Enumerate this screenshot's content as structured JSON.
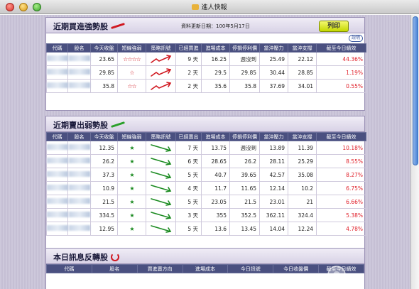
{
  "window": {
    "title": "進人快報"
  },
  "top_panel": {
    "title": "近期買進強勢股",
    "update_text": "資料更新日期：100年5月17日",
    "print_label": "列印",
    "help_label": "說明",
    "columns": [
      "代碼",
      "股名",
      "今天收盤",
      "短線強弱",
      "策略訊號",
      "已經買進",
      "進場成本",
      "停損停利價",
      "當沖壓力",
      "當沖支撐",
      "截至今日績效"
    ],
    "rows": [
      {
        "close": "23.65",
        "stars": "☆☆☆☆",
        "days": "9 天",
        "cost": "16.25",
        "stop": "週沒到",
        "resist": "25.49",
        "support": "22.12",
        "perf": "44.36%"
      },
      {
        "close": "29.85",
        "stars": "☆",
        "days": "2 天",
        "cost": "29.5",
        "stop": "29.85",
        "resist": "30.44",
        "support": "28.85",
        "perf": "1.19%"
      },
      {
        "close": "35.8",
        "stars": "☆☆",
        "days": "2 天",
        "cost": "35.6",
        "stop": "35.8",
        "resist": "37.69",
        "support": "34.01",
        "perf": "0.55%"
      }
    ]
  },
  "mid_panel": {
    "title": "近期賣出弱勢股",
    "columns": [
      "代碼",
      "股名",
      "今天收盤",
      "短線強弱",
      "策略訊號",
      "已經賣出",
      "進場成本",
      "停損停利價",
      "當沖壓力",
      "當沖支撐",
      "截至今日績效"
    ],
    "rows": [
      {
        "close": "12.35",
        "stars": "★",
        "days": "7 天",
        "cost": "13.75",
        "stop": "週沒到",
        "resist": "13.89",
        "support": "11.39",
        "perf": "10.18%"
      },
      {
        "close": "26.2",
        "stars": "★",
        "days": "6 天",
        "cost": "28.65",
        "stop": "26.2",
        "resist": "28.11",
        "support": "25.29",
        "perf": "8.55%"
      },
      {
        "close": "37.3",
        "stars": "★",
        "days": "5 天",
        "cost": "40.7",
        "stop": "39.65",
        "resist": "42.57",
        "support": "35.08",
        "perf": "8.27%"
      },
      {
        "close": "10.9",
        "stars": "★",
        "days": "4 天",
        "cost": "11.7",
        "stop": "11.65",
        "resist": "12.14",
        "support": "10.2",
        "perf": "6.75%"
      },
      {
        "close": "21.5",
        "stars": "★",
        "days": "5 天",
        "cost": "23.05",
        "stop": "21.5",
        "resist": "23.01",
        "support": "21",
        "perf": "6.66%"
      },
      {
        "close": "334.5",
        "stars": "★",
        "days": "3 天",
        "cost": "355",
        "stop": "352.5",
        "resist": "362.11",
        "support": "324.4",
        "perf": "5.38%"
      },
      {
        "close": "12.95",
        "stars": "★",
        "days": "5 天",
        "cost": "13.6",
        "stop": "13.45",
        "resist": "14.04",
        "support": "12.24",
        "perf": "4.78%"
      }
    ]
  },
  "bottom_panel": {
    "title": "本日訊息反轉股",
    "columns": [
      "代碼",
      "股名",
      "買進賣方向",
      "進場成本",
      "今日訊號",
      "今日收盤價",
      "截至今日績效"
    ]
  },
  "colors": {
    "header_bg": "#4a5080",
    "perf_red": "#e0202a",
    "buy_arrow": "#d01820",
    "sell_arrow": "#1a8a20",
    "print_btn": "#dbe830"
  }
}
